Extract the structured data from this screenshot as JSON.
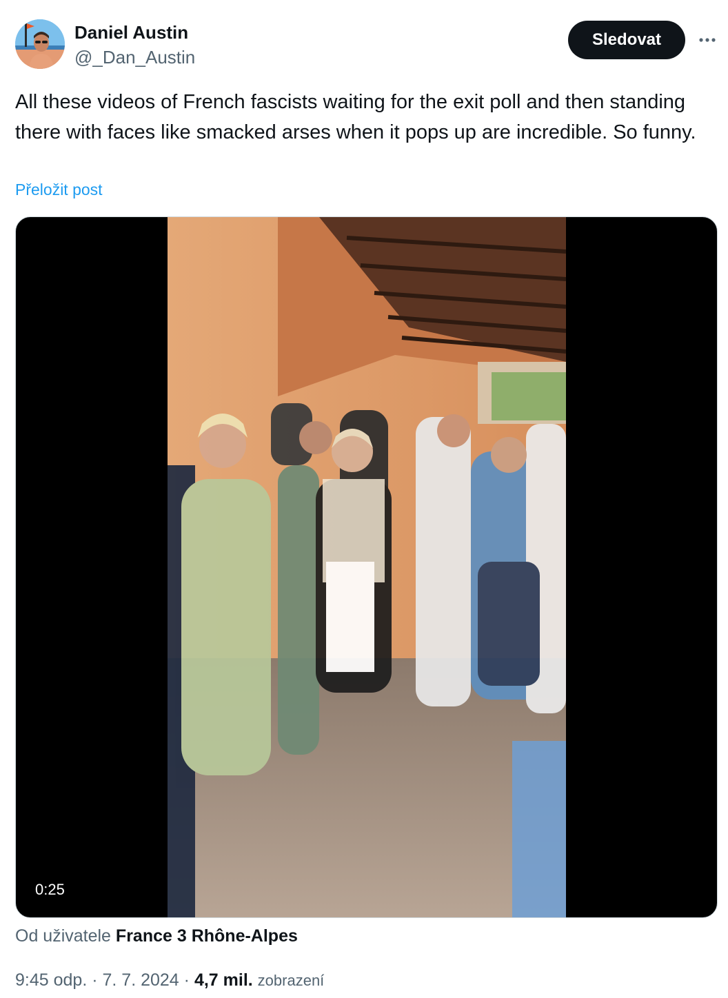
{
  "author": {
    "name": "Daniel Austin",
    "handle": "@_Dan_Austin",
    "avatar_icon": "profile-photo"
  },
  "follow_label": "Sledovat",
  "more_icon": "ellipsis-horizontal-icon",
  "tweet": {
    "text": "All these videos of French fascists waiting for the exit poll and then standing there with faces like smacked arses when it pops up are incredible. So funny.",
    "translate_label": "Přeložit post"
  },
  "video": {
    "duration": "0:25"
  },
  "attribution": {
    "prefix": "Od uživatele",
    "source": "France 3 Rhône-Alpes"
  },
  "meta": {
    "time": "9:45 odp.",
    "separator": "·",
    "date": "7. 7. 2024",
    "views_count": "4,7 mil.",
    "views_label": "zobrazení"
  },
  "colors": {
    "link": "#1d9bf0",
    "text_primary": "#0f1419",
    "text_secondary": "#536471",
    "button_bg": "#0f1419"
  }
}
